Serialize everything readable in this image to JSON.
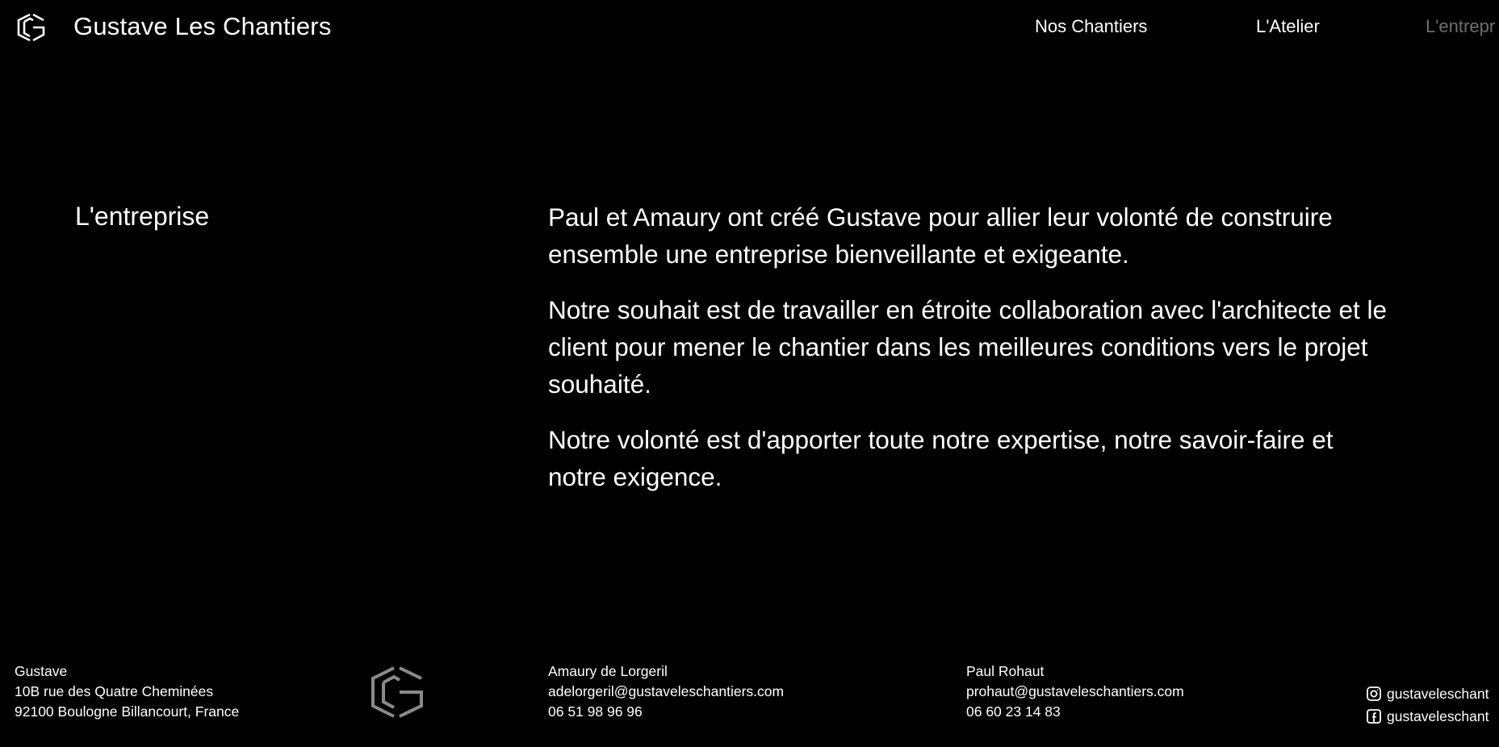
{
  "header": {
    "brand": "Gustave Les Chantiers",
    "nav": [
      {
        "label": "Nos Chantiers"
      },
      {
        "label": "L'Atelier"
      },
      {
        "label": "L'entrepr"
      }
    ]
  },
  "main": {
    "section_title": "L'entreprise",
    "paragraphs": [
      "Paul et Amaury ont créé Gustave pour allier leur volonté de construire ensemble une entreprise bienveillante et exigeante.",
      "Notre souhait est de travailler en étroite collaboration avec l'architecte et le client pour mener le chantier dans les meilleures conditions vers le projet souhaité.",
      "Notre volonté est d'apporter toute notre expertise, notre savoir-faire et notre exigence."
    ]
  },
  "footer": {
    "company": {
      "name": "Gustave",
      "street": "10B rue des Quatre Cheminées",
      "city": "92100 Boulogne Billancourt, France"
    },
    "amaury": {
      "name": "Amaury de Lorgeril",
      "email": "adelorgeril@gustaveleschantiers.com",
      "phone": "06 51 98 96 96"
    },
    "paul": {
      "name": "Paul Rohaut",
      "email": "prohaut@gustaveleschantiers.com",
      "phone": "06 60 23 14 83"
    },
    "social": {
      "instagram": "gustaveleschant",
      "facebook": "gustaveleschant"
    }
  },
  "colors": {
    "background": "#000000",
    "text": "#ffffff",
    "nav_active": "#6e6e6e",
    "footer_logo": "#8a8a8a"
  },
  "icons": [
    "logo-mark-icon",
    "footer-logo-icon",
    "instagram-icon",
    "facebook-icon"
  ]
}
